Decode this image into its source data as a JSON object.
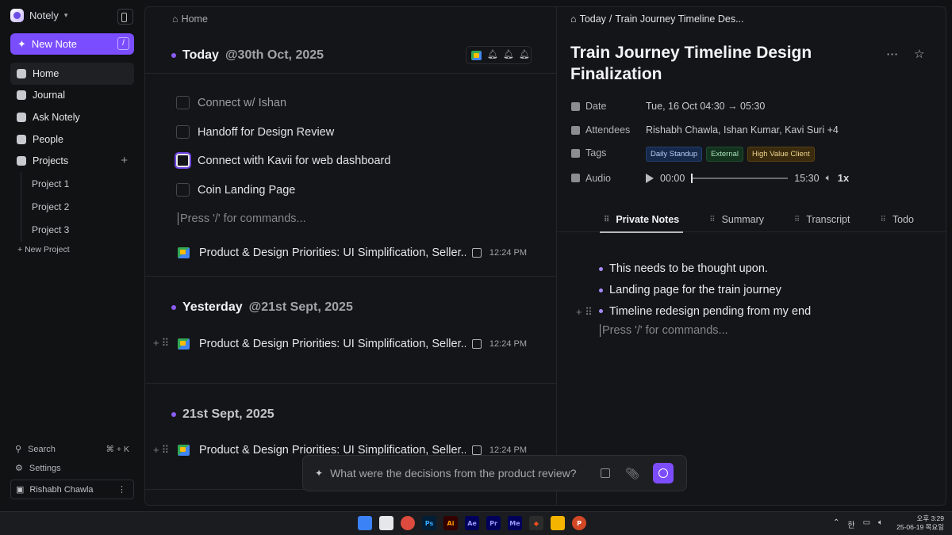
{
  "sidebar": {
    "app_name": "Notely",
    "new_note_label": "New Note",
    "new_note_shortcut": "/",
    "nav": [
      {
        "label": "Home"
      },
      {
        "label": "Journal"
      },
      {
        "label": "Ask Notely"
      },
      {
        "label": "People"
      },
      {
        "label": "Projects"
      }
    ],
    "projects": [
      "Project 1",
      "Project 2",
      "Project 3"
    ],
    "new_project_label": "New Project",
    "search_label": "Search",
    "search_shortcut": "⌘ + K",
    "settings_label": "Settings",
    "user_name": "Rishabh Chawla"
  },
  "middle": {
    "breadcrumb": "Home",
    "sections": [
      {
        "label": "Today",
        "date": "@30th Oct, 2025"
      },
      {
        "label": "Yesterday",
        "date": "@21st Sept, 2025"
      },
      {
        "label": "",
        "date": "21st Sept, 2025"
      }
    ],
    "todos": [
      {
        "text": "Connect w/ Ishan",
        "checked": false
      },
      {
        "text": "Handoff for Design Review",
        "checked": false
      },
      {
        "text": "Connect with Kavii for web dashboard",
        "checked": false
      },
      {
        "text": "Coin Landing Page",
        "checked": false
      }
    ],
    "command_placeholder": "Press '/' for commands...",
    "meetings": [
      {
        "title": "Product & Design Priorities: UI Simplification, Seller...",
        "time": "12:24 PM"
      },
      {
        "title": "Product & Design Priorities: UI Simplification, Seller...",
        "time": "12:24 PM"
      },
      {
        "title": "Product & Design Priorities: UI Simplification, Seller...",
        "time": "12:24 PM"
      }
    ]
  },
  "detail": {
    "breadcrumb_root": "Today",
    "breadcrumb_sep": "/",
    "breadcrumb_current": "Train Journey Timeline Des...",
    "title": "Train Journey Timeline Design Finalization",
    "date_label": "Date",
    "date_value": "Tue, 16 Oct 04:30 → 05:30",
    "attendees_label": "Attendees",
    "attendees_value": "Rishabh Chawla, Ishan Kumar, Kavi Suri +4",
    "tags_label": "Tags",
    "tags": [
      {
        "label": "Daily Standup",
        "color": "#16294b"
      },
      {
        "label": "External",
        "color": "#14331f"
      },
      {
        "label": "High Value Client",
        "color": "#3a2b0e"
      }
    ],
    "audio_label": "Audio",
    "audio_current": "00:00",
    "audio_total": "15:30",
    "audio_progress": 0,
    "audio_speed": "1x",
    "tabs": [
      "Private Notes",
      "Summary",
      "Transcript",
      "Todo"
    ],
    "active_tab": "Private Notes",
    "notes": [
      "This needs to be thought upon.",
      "Landing page for the train journey",
      "Timeline redesign pending from my end"
    ],
    "command_placeholder": "Press '/' for commands..."
  },
  "ask": {
    "placeholder": "What were the decisions from the product review?"
  },
  "taskbar": {
    "time": "오후 3:29",
    "date": "25-06-19 목요일",
    "ime": "한"
  },
  "colors": {
    "accent": "#7a4dff",
    "bullet": "#a78bfa"
  }
}
